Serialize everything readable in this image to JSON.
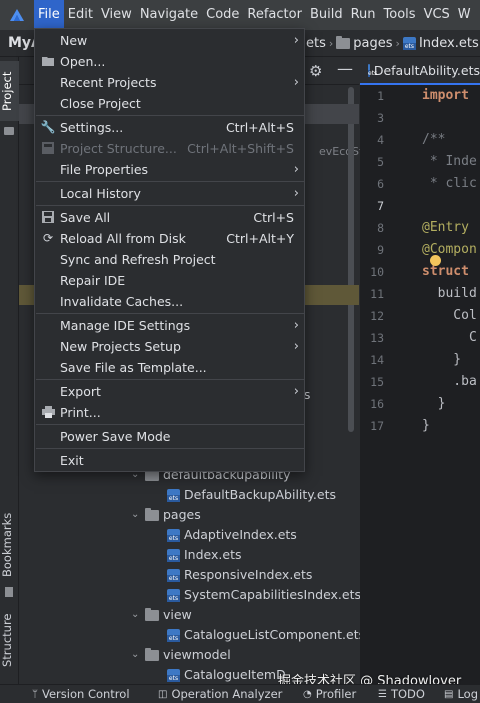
{
  "menubar": {
    "items": [
      "File",
      "Edit",
      "View",
      "Navigate",
      "Code",
      "Refactor",
      "Build",
      "Run",
      "Tools",
      "VCS",
      "W"
    ],
    "active": "File"
  },
  "navbar": {
    "project_name": "MyA",
    "crumbs": [
      "ets",
      "pages",
      "Index.ets"
    ]
  },
  "left_strip": {
    "tabs": [
      "Project",
      "Bookmarks",
      "Structure"
    ]
  },
  "project_panel": {
    "hint_text": "evEcoStu",
    "rows_right": [
      {
        "text": "ts"
      }
    ],
    "tree": [
      {
        "text": "defaultbackupability",
        "type": "folder",
        "expanded": true
      },
      {
        "text": "DefaultBackupAbility.ets",
        "type": "file"
      },
      {
        "text": "pages",
        "type": "folder",
        "expanded": true
      },
      {
        "text": "AdaptiveIndex.ets",
        "type": "file"
      },
      {
        "text": "Index.ets",
        "type": "file"
      },
      {
        "text": "ResponsiveIndex.ets",
        "type": "file"
      },
      {
        "text": "SystemCapabilitiesIndex.ets",
        "type": "file"
      },
      {
        "text": "view",
        "type": "folder",
        "expanded": true
      },
      {
        "text": "CatalogueListComponent.ets",
        "type": "file"
      },
      {
        "text": "viewmodel",
        "type": "folder",
        "expanded": true
      },
      {
        "text": "CatalogueItemD",
        "type": "file"
      }
    ]
  },
  "editor": {
    "tab_label": "DefaultAbility.ets",
    "line_numbers": [
      "1",
      "3",
      "4",
      "5",
      "6",
      "7",
      "8",
      "9",
      "10",
      "11",
      "12",
      "13",
      "14",
      "15",
      "16",
      "17"
    ],
    "current_line": "7",
    "code_lines": [
      "import",
      "",
      "/**",
      " * Inde",
      " * clic",
      "",
      "@Entry",
      "@Compon",
      "struct",
      "  build",
      "    Col",
      "      C",
      "    }",
      "    .ba",
      "  }",
      "}"
    ]
  },
  "file_menu": {
    "items": [
      {
        "label": "New",
        "submenu": true
      },
      {
        "label": "Open...",
        "icon": "folder-open-icon"
      },
      {
        "label": "Recent Projects",
        "submenu": true
      },
      {
        "label": "Close Project"
      },
      {
        "label": "Settings...",
        "shortcut": "Ctrl+Alt+S",
        "icon": "wrench-icon"
      },
      {
        "label": "Project Structure...",
        "shortcut": "Ctrl+Alt+Shift+S",
        "disabled": true,
        "icon": "project-structure-icon"
      },
      {
        "label": "File Properties",
        "submenu": true
      },
      {
        "label": "Local History",
        "submenu": true
      },
      {
        "label": "Save All",
        "shortcut": "Ctrl+S",
        "icon": "save-icon"
      },
      {
        "label": "Reload All from Disk",
        "shortcut": "Ctrl+Alt+Y",
        "icon": "reload-icon"
      },
      {
        "label": "Sync and Refresh Project"
      },
      {
        "label": "Repair IDE"
      },
      {
        "label": "Invalidate Caches..."
      },
      {
        "label": "Manage IDE Settings",
        "submenu": true
      },
      {
        "label": "New Projects Setup",
        "submenu": true
      },
      {
        "label": "Save File as Template..."
      },
      {
        "label": "Export",
        "submenu": true
      },
      {
        "label": "Print...",
        "icon": "print-icon"
      },
      {
        "label": "Power Save Mode"
      },
      {
        "label": "Exit"
      }
    ]
  },
  "bottombar": {
    "tools": [
      "Version Control",
      "Operation Analyzer",
      "Profiler",
      "TODO",
      "Log"
    ]
  },
  "watermark": "掘金技术社区 @ Shadowlover"
}
